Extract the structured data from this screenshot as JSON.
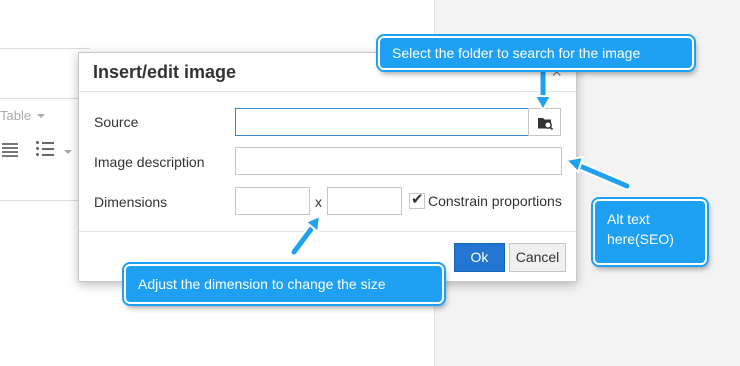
{
  "background": {
    "toolbar_table_label": "Table"
  },
  "dialog": {
    "title": "Insert/edit image",
    "close_glyph": "×",
    "fields": {
      "source_label": "Source",
      "source_value": "",
      "description_label": "Image description",
      "description_value": "",
      "dimensions_label": "Dimensions",
      "width_value": "",
      "height_value": "",
      "dimension_separator": "x",
      "constrain_label": "Constrain proportions",
      "constrain_checked": true
    },
    "buttons": {
      "ok_label": "Ok",
      "cancel_label": "Cancel"
    },
    "browse_icon": "folder-search-icon"
  },
  "callouts": {
    "folder": "Select the folder to search for the image",
    "alt_line1": "Alt text",
    "alt_line2": "here(SEO)",
    "dimension": "Adjust the dimension to change the size"
  },
  "colors": {
    "callout_blue": "#1ea0f3",
    "ok_button_blue": "#2276d2",
    "focused_input_border": "#3d87c9"
  }
}
